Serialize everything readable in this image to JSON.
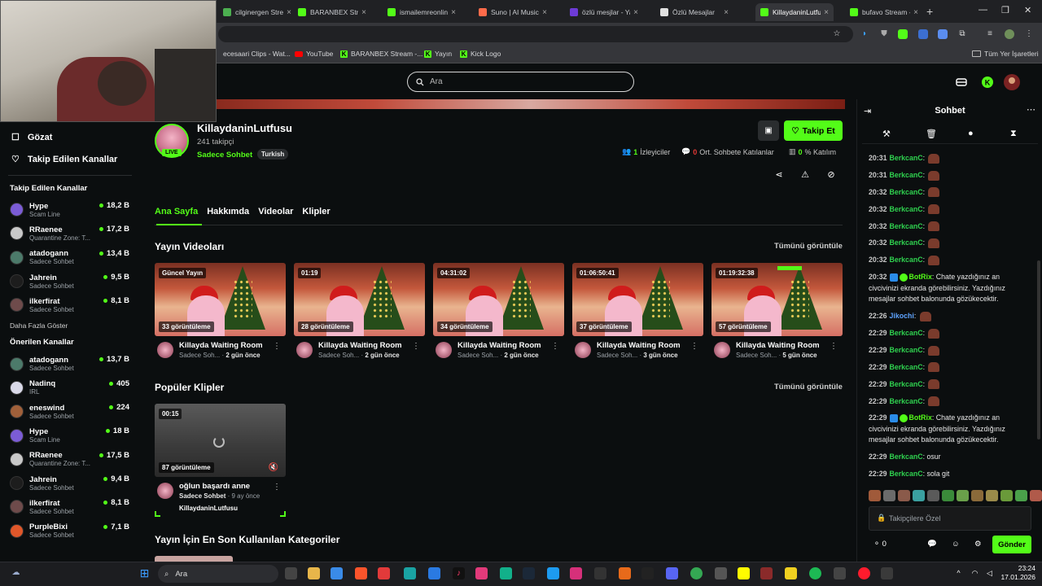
{
  "browser": {
    "tabs": [
      {
        "label": "cilginergen Stream",
        "color": "#4caf50"
      },
      {
        "label": "BARANBEX Stream",
        "color": "#53fc18"
      },
      {
        "label": "ismailemreonline",
        "color": "#53fc18"
      },
      {
        "label": "Suno | AI Music",
        "color": "#ff6b4a"
      },
      {
        "label": "özlü mesjlar - Yah",
        "color": "#6d3bd6"
      },
      {
        "label": "Özlü Mesajlar",
        "color": "#e0e0e0"
      },
      {
        "label": "KillaydaninLutfus",
        "color": "#53fc18"
      },
      {
        "label": "bufavo Stream - K",
        "color": "#53fc18"
      }
    ],
    "bookmarks": [
      {
        "label": "ecesaari Clips - Wat..."
      },
      {
        "label": "YouTube"
      },
      {
        "label": "BARANBEX Stream -..."
      },
      {
        "label": "Yayın"
      },
      {
        "label": "Kick Logo"
      }
    ],
    "all_bookmarks": "Tüm Yer İşaretleri"
  },
  "site": {
    "search_placeholder": "Ara"
  },
  "sidebar": {
    "nav": [
      {
        "label": "Gözat",
        "icon": "compass-icon"
      },
      {
        "label": "Takip Edilen Kanallar",
        "icon": "heart-icon"
      }
    ],
    "followed_title": "Takip Edilen Kanallar",
    "followed": [
      {
        "name": "Hype",
        "category": "Scam Line",
        "viewers": "18,2 B",
        "avatar": "#7b5cd6"
      },
      {
        "name": "RRaenee",
        "category": "Quarantine Zone: T...",
        "viewers": "17,2 B",
        "avatar": "#c9c9c9"
      },
      {
        "name": "atadogann",
        "category": "Sadece Sohbet",
        "viewers": "13,4 B",
        "avatar": "#4c7a6a"
      },
      {
        "name": "Jahrein",
        "category": "Sadece Sohbet",
        "viewers": "9,5 B",
        "avatar": "#1d1d1d"
      },
      {
        "name": "ilkerfirat",
        "category": "Sadece Sohbet",
        "viewers": "8,1 B",
        "avatar": "#6e4b4b"
      }
    ],
    "show_more": "Daha Fazla Göster",
    "recommended_title": "Önerilen Kanallar",
    "recommended": [
      {
        "name": "atadogann",
        "category": "Sadece Sohbet",
        "viewers": "13,7 B",
        "avatar": "#4c7a6a"
      },
      {
        "name": "Nadinq",
        "category": "IRL",
        "viewers": "405",
        "avatar": "#d9d9e8"
      },
      {
        "name": "eneswind",
        "category": "Sadece Sohbet",
        "viewers": "224",
        "avatar": "#a0603a"
      },
      {
        "name": "Hype",
        "category": "Scam Line",
        "viewers": "18 B",
        "avatar": "#7b5cd6"
      },
      {
        "name": "RRaenee",
        "category": "Quarantine Zone: T...",
        "viewers": "17,5 B",
        "avatar": "#c9c9c9"
      },
      {
        "name": "Jahrein",
        "category": "Sadece Sohbet",
        "viewers": "9,4 B",
        "avatar": "#1d1d1d"
      },
      {
        "name": "ilkerfirat",
        "category": "Sadece Sohbet",
        "viewers": "8,1 B",
        "avatar": "#6e4b4b"
      },
      {
        "name": "PurpleBixi",
        "category": "Sadece Sohbet",
        "viewers": "7,1 B",
        "avatar": "#e0572a"
      }
    ]
  },
  "channel": {
    "name": "KillaydaninLutfusu",
    "followers": "241 takipçi",
    "category": "Sadece Sohbet",
    "tag": "Turkish",
    "live_label": "LIVE",
    "follow_label": "Takip Et",
    "viewers_value": "1",
    "viewers_label": "İzleyiciler",
    "chatters_value": "0",
    "chatters_label": "Ort. Sohbete Katılanlar",
    "participation_value": "0",
    "participation_label": "% Katılım"
  },
  "tabs": [
    "Ana Sayfa",
    "Hakkımda",
    "Videolar",
    "Klipler"
  ],
  "videos_section": {
    "title": "Yayın Videoları",
    "see_all": "Tümünü görüntüle",
    "items": [
      {
        "duration": "Güncel Yayın",
        "views": "33 görüntüleme",
        "title": "Killayda Waiting Room",
        "category": "Sadece Soh...",
        "age": "2 gün önce"
      },
      {
        "duration": "01:19",
        "views": "28 görüntüleme",
        "title": "Killayda Waiting Room",
        "category": "Sadece Soh...",
        "age": "2 gün önce"
      },
      {
        "duration": "04:31:02",
        "views": "34 görüntüleme",
        "title": "Killayda Waiting Room",
        "category": "Sadece Soh...",
        "age": "2 gün önce"
      },
      {
        "duration": "01:06:50:41",
        "views": "37 görüntüleme",
        "title": "Killayda Waiting Room",
        "category": "Sadece Soh...",
        "age": "3 gün önce"
      },
      {
        "duration": "01:19:32:38",
        "views": "57 görüntüleme",
        "title": "Killayda Waiting Room",
        "category": "Sadece Soh...",
        "age": "5 gün önce"
      }
    ]
  },
  "clips_section": {
    "title": "Popüler Klipler",
    "see_all": "Tümünü görüntüle",
    "items": [
      {
        "duration": "00:15",
        "views": "87 görüntüleme",
        "title": "oğlun başardı anne",
        "category": "Sadece Sohbet",
        "age": "9 ay önce",
        "channel": "KillaydaninLutfusu"
      }
    ]
  },
  "categories_section": {
    "title": "Yayın İçin En Son Kullanılan Kategoriler"
  },
  "chat": {
    "title": "Sohbet",
    "messages": [
      {
        "time": "20:31",
        "user": "BerkcanC",
        "text": "",
        "emote": true,
        "type": "user"
      },
      {
        "time": "20:31",
        "user": "BerkcanC",
        "text": "",
        "emote": true,
        "type": "user"
      },
      {
        "time": "20:32",
        "user": "BerkcanC",
        "text": "",
        "emote": true,
        "type": "user"
      },
      {
        "time": "20:32",
        "user": "BerkcanC",
        "text": "",
        "emote": true,
        "type": "user"
      },
      {
        "time": "20:32",
        "user": "BerkcanC",
        "text": "",
        "emote": true,
        "type": "user"
      },
      {
        "time": "20:32",
        "user": "BerkcanC",
        "text": "",
        "emote": true,
        "type": "user"
      },
      {
        "time": "20:32",
        "user": "BerkcanC",
        "text": "",
        "emote": true,
        "type": "user"
      },
      {
        "time": "20:32",
        "user": "BotRix",
        "text": "Chate yazdığınız an civcivinizi ekranda görebilirsiniz. Yazdığınız mesajlar sohbet balonunda gözükecektir.",
        "emote": false,
        "type": "bot"
      },
      {
        "time": "22:26",
        "user": "Jikochi",
        "text": "",
        "emote": true,
        "type": "jk"
      },
      {
        "time": "22:29",
        "user": "BerkcanC",
        "text": "",
        "emote": true,
        "type": "user"
      },
      {
        "time": "22:29",
        "user": "BerkcanC",
        "text": "",
        "emote": true,
        "type": "user"
      },
      {
        "time": "22:29",
        "user": "BerkcanC",
        "text": "",
        "emote": true,
        "type": "user"
      },
      {
        "time": "22:29",
        "user": "BerkcanC",
        "text": "",
        "emote": true,
        "type": "user"
      },
      {
        "time": "22:29",
        "user": "BerkcanC",
        "text": "",
        "emote": true,
        "type": "user"
      },
      {
        "time": "22:29",
        "user": "BotRix",
        "text": "Chate yazdığınız an civcivinizi ekranda görebilirsiniz. Yazdığınız mesajlar sohbet balonunda gözükecektir.",
        "emote": false,
        "type": "bot"
      },
      {
        "time": "22:29",
        "user": "BerkcanC",
        "text": "osur",
        "emote": false,
        "type": "user"
      },
      {
        "time": "22:29",
        "user": "BerkcanC",
        "text": "sola git",
        "emote": false,
        "type": "user"
      }
    ],
    "input_placeholder": "Takipçilere Özel",
    "points": "0",
    "send_label": "Gönder"
  },
  "taskbar": {
    "search_placeholder": "Ara",
    "time": "23:24",
    "date": "17.01.2026"
  }
}
